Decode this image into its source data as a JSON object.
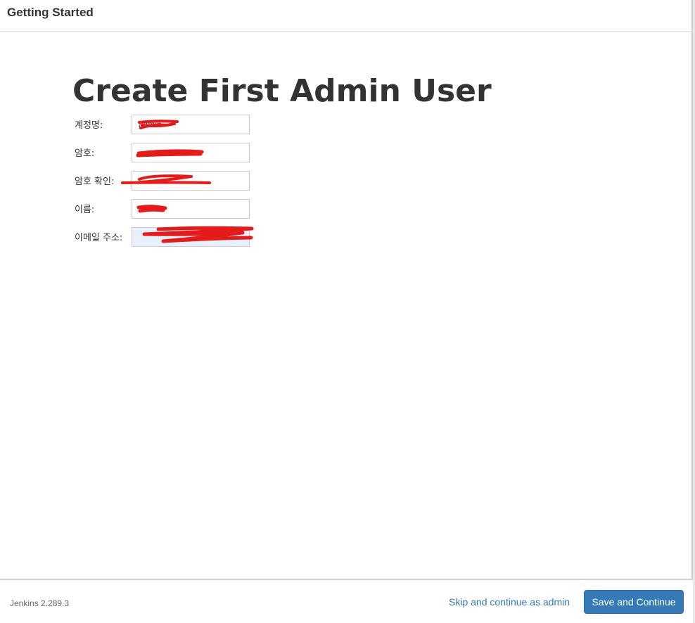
{
  "header": {
    "title": "Getting Started"
  },
  "page": {
    "title": "Create First Admin User"
  },
  "form": {
    "fields": [
      {
        "label": "계정명:",
        "value": "admin"
      },
      {
        "label": "암호:",
        "value": ""
      },
      {
        "label": "암호 확인:",
        "value": ""
      },
      {
        "label": "이름:",
        "value": ""
      },
      {
        "label": "이메일 주소:",
        "value": ""
      }
    ]
  },
  "footer": {
    "version": "Jenkins 2.289.3",
    "skip_label": "Skip and continue as admin",
    "save_label": "Save and Continue"
  },
  "colors": {
    "primary": "#337ab7",
    "link": "#337ab7",
    "redaction": "#e31b1b"
  }
}
